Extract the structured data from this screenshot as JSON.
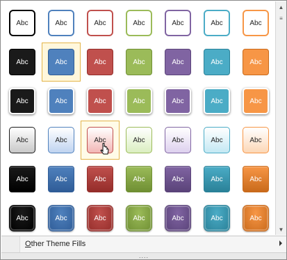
{
  "swatch_label": "Abc",
  "theme_colors": [
    {
      "name": "black",
      "base": "#1a1a1a",
      "dark": "#000000",
      "light": "#c8c8c8"
    },
    {
      "name": "blue",
      "base": "#4f81bd",
      "dark": "#2f5c97",
      "light": "#bfd3f0"
    },
    {
      "name": "red",
      "base": "#c0504d",
      "dark": "#942d2a",
      "light": "#f2b6b4"
    },
    {
      "name": "green",
      "base": "#9bbb59",
      "dark": "#6f8f33",
      "light": "#dbeec0"
    },
    {
      "name": "purple",
      "base": "#8064a2",
      "dark": "#5a4379",
      "light": "#ddd0ee"
    },
    {
      "name": "aqua",
      "base": "#4bacc6",
      "dark": "#2a8198",
      "light": "#c3e8f3"
    },
    {
      "name": "orange",
      "base": "#f79646",
      "dark": "#c96a1b",
      "light": "#fcd7b6"
    }
  ],
  "row_styles": [
    "outline",
    "solid",
    "white-border",
    "light-gradient",
    "glossy",
    "bevel"
  ],
  "selected_cell": {
    "row": 1,
    "col": 1
  },
  "hover_cell": {
    "row": 3,
    "col": 2
  },
  "menu": {
    "other_theme_fills_prefix": "O",
    "other_theme_fills_rest": "ther Theme Fills"
  },
  "grip_text": "....",
  "scrollbar": {
    "up_glyph": "▲",
    "down_glyph": "▼",
    "mid_glyph": "≡"
  }
}
